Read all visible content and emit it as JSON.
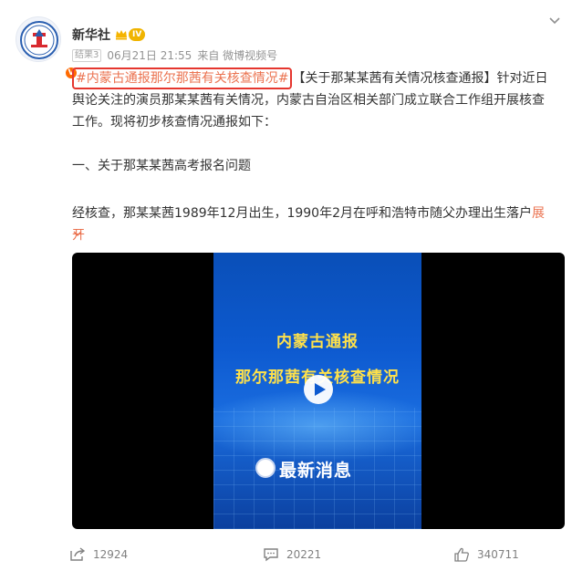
{
  "post": {
    "author": "新华社",
    "level": "IV",
    "verified_mark": "V",
    "source_tag": "结果3",
    "time": "06月21日 21:55",
    "source": "来自 微博视频号",
    "hashtag": "#内蒙古通报那尔那茜有关核查情况#",
    "intro": "【关于那某某茜有关情况核查通报】针对近日舆论关注的演员那某某茜有关情况，内蒙古自治区相关部门成立联合工作组开展核查工作。现将初步核查情况通报如下：",
    "section_title": "一、关于那某某茜高考报名问题",
    "detail": "经核查，那某某茜1989年12月出生，1990年2月在呼和浩特市随父办理出生落户",
    "expand_label": "展开"
  },
  "video": {
    "title_line1": "内蒙古通报",
    "title_line2": "那尔那茜有关核查情况",
    "banner": "最新消息"
  },
  "actions": {
    "share_count": "12924",
    "comment_count": "20221",
    "like_count": "340711"
  },
  "icons": {
    "share": "share-icon",
    "comment": "comment-icon",
    "like": "like-icon",
    "menu": "chevron-down-icon",
    "play": "play-icon"
  },
  "colors": {
    "hashtag": "#eb7350",
    "highlight_border": "#e5362e",
    "poster_text": "#ffe14a",
    "verified": "#ff6a00"
  }
}
